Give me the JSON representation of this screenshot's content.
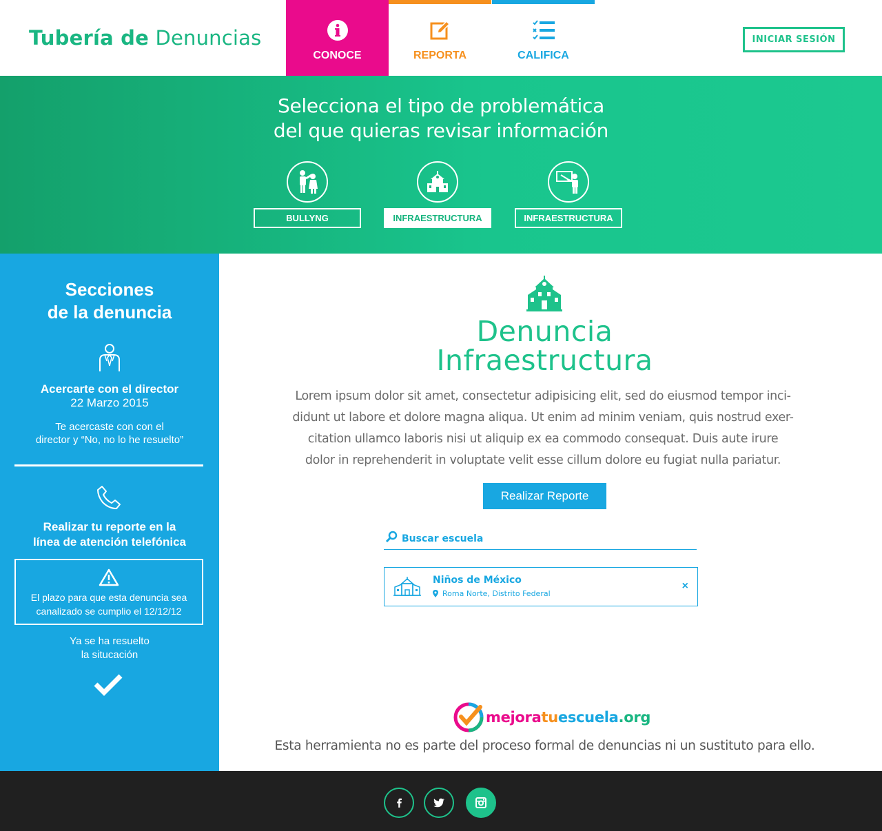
{
  "brand": {
    "bold": "Tubería de",
    "light": "Denuncias"
  },
  "nav": {
    "conoce": "CONOCE",
    "reporta": "REPORTA",
    "califica": "CALIFICA"
  },
  "login_label": "INICIAR SESIÓN",
  "hero": {
    "line1": "Selecciona el tipo de problemática",
    "line2": "del que quieras revisar información",
    "categories": [
      {
        "label": "BULLYNG",
        "icon": "bullying-icon"
      },
      {
        "label": "INFRAESTRUCTURA",
        "icon": "school-icon"
      },
      {
        "label": "INFRAESTRUCTURA",
        "icon": "teacher-icon"
      }
    ]
  },
  "sidebar": {
    "title1": "Secciones",
    "title2": "de la denuncia",
    "director_title": "Acercarte con el director",
    "director_date": "22 Marzo 2015",
    "director_note1": "Te acercaste con con el",
    "director_note2": "director y “No, no lo he resuelto”",
    "phone_title1": "Realizar tu reporte en la",
    "phone_title2": "línea de atención telefónica",
    "warning1": "El plazo para que esta denuncia sea",
    "warning2": "canalizado se cumplio el 12/12/12",
    "resolved1": "Ya se ha resuelto",
    "resolved2": "la situcación"
  },
  "main": {
    "title1": "Denuncia",
    "title2": "Infraestructura",
    "lorem1": "Lorem ipsum dolor sit amet, consectetur adipisicing elit, sed do eiusmod tempor inci-",
    "lorem2": "didunt ut labore et dolore magna aliqua. Ut enim ad minim veniam, quis nostrud exer-",
    "lorem3": "citation ullamco laboris nisi ut aliquip ex ea commodo consequat. Duis aute irure",
    "lorem4": "dolor in reprehenderit in voluptate velit esse cillum dolore eu fugiat nulla pariatur.",
    "report_button": "Realizar Reporte",
    "search_placeholder": "Buscar escuela",
    "result": {
      "name": "Niños de México",
      "location": "Roma Norte, Distrito Federal",
      "close": "×"
    },
    "logo": {
      "p1": "mejora",
      "p2": "tu",
      "p3": "escuela",
      "p4": ".org"
    },
    "disclaimer": "Esta herramienta no es parte del proceso formal de denuncias ni un sustituto para ello."
  },
  "colors": {
    "green": "#1ec28b",
    "magenta": "#ea0b8c",
    "orange": "#f6901e",
    "blue": "#18a7e1",
    "footer": "#202020"
  },
  "social": [
    "facebook-icon",
    "twitter-icon",
    "instagram-icon"
  ]
}
